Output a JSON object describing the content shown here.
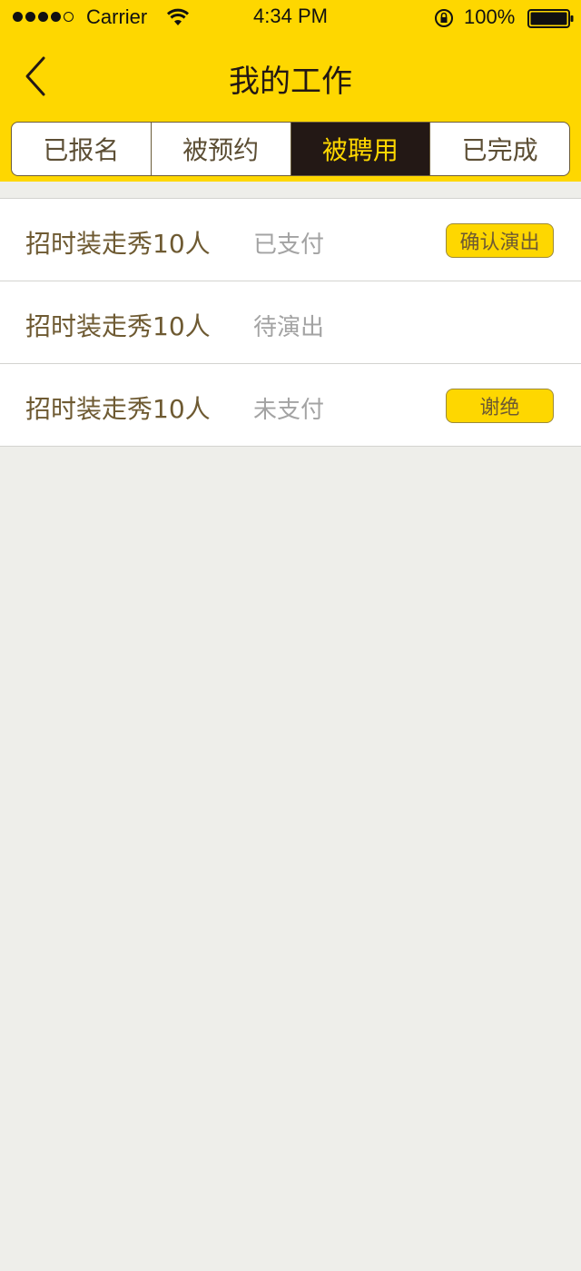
{
  "status_bar": {
    "carrier": "Carrier",
    "time": "4:34 PM",
    "battery": "100%"
  },
  "nav": {
    "title": "我的工作",
    "back_icon": "chevron-left-icon"
  },
  "tabs": [
    {
      "label": "已报名",
      "active": false
    },
    {
      "label": "被预约",
      "active": false
    },
    {
      "label": "被聘用",
      "active": true
    },
    {
      "label": "已完成",
      "active": false
    }
  ],
  "rows": [
    {
      "title": "招时装走秀10人",
      "status": "已支付",
      "action": "确认演出"
    },
    {
      "title": "招时装走秀10人",
      "status": "待演出",
      "action": ""
    },
    {
      "title": "招时装走秀10人",
      "status": "未支付",
      "action": "谢绝"
    }
  ],
  "colors": {
    "accent": "#fed700",
    "active_tab_bg": "#231815",
    "page_bg": "#eeeeea"
  }
}
